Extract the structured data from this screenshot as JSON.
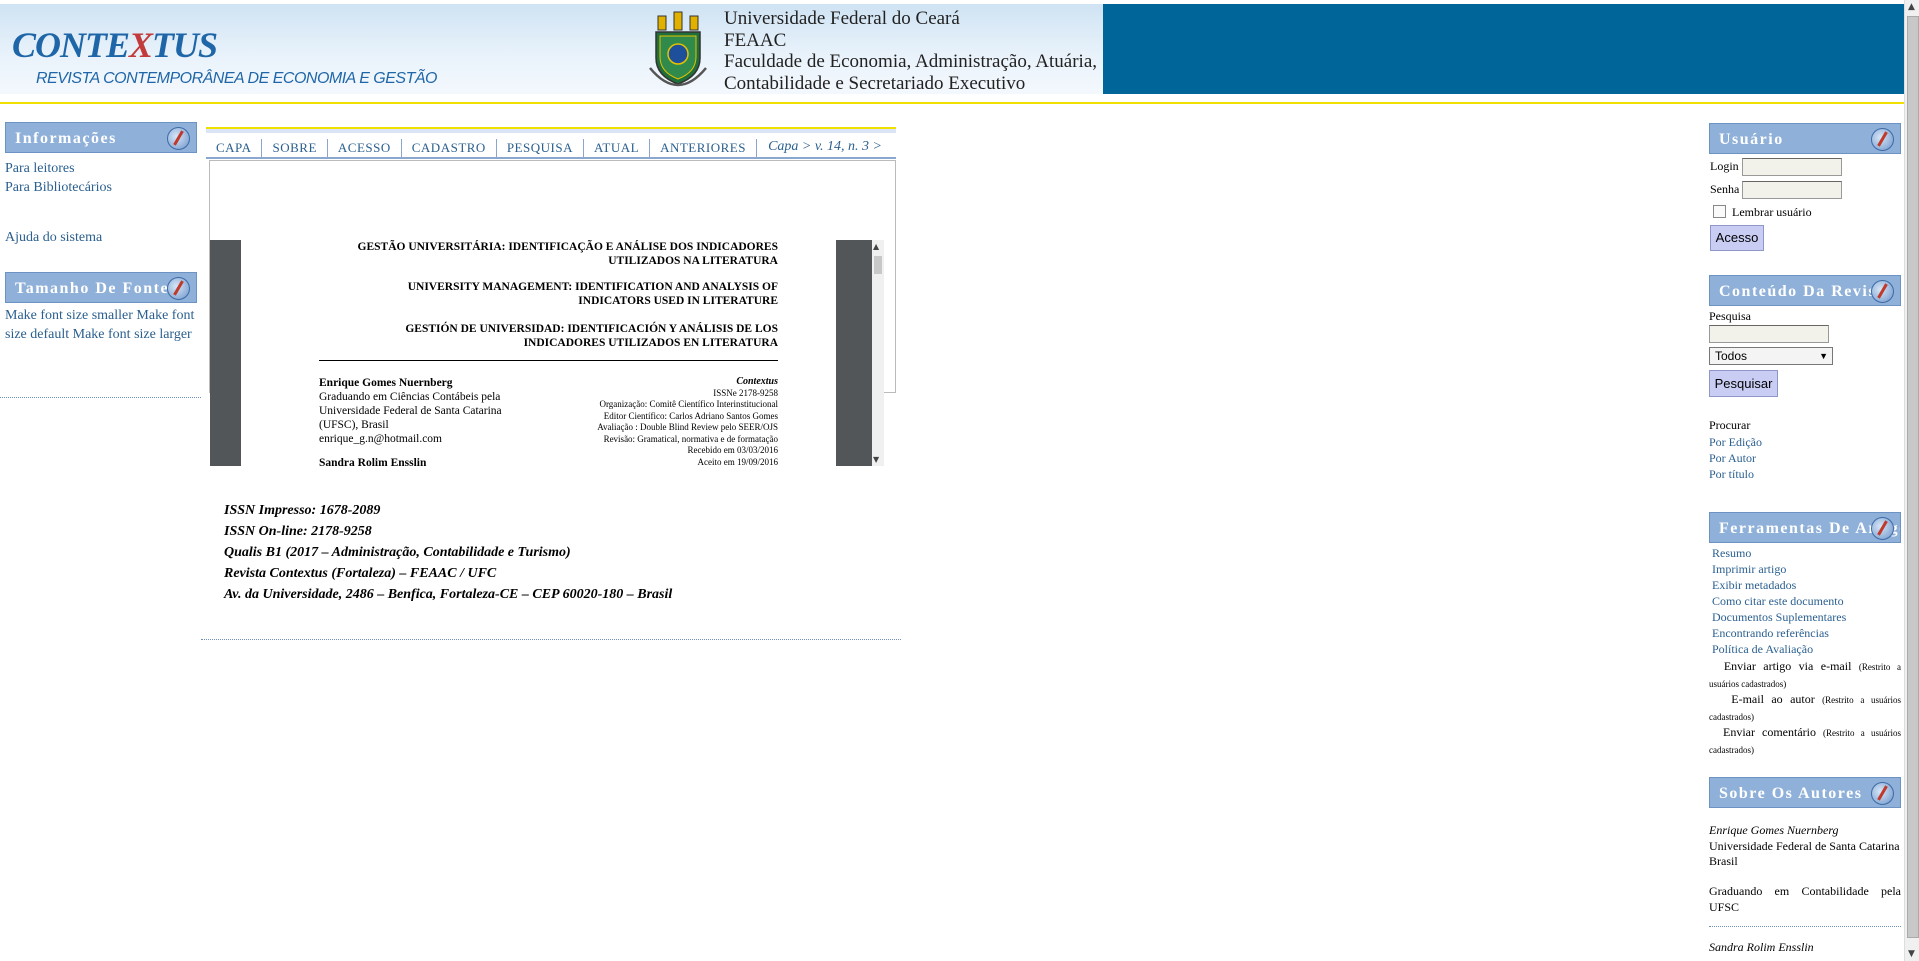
{
  "header": {
    "logo_title_a": "CONTE",
    "logo_title_x": "X",
    "logo_title_b": "TUS",
    "logo_subtitle": "REVISTA CONTEMPORÂNEA DE ECONOMIA E GESTÃO",
    "university_lines": [
      "Universidade Federal do Ceará",
      "FEAAC",
      "Faculdade de Economia, Administração, Atuária,",
      "Contabilidade e Secretariado Executivo"
    ]
  },
  "left_sidebar": {
    "info_header": "Informações",
    "info_links": [
      "Para leitores",
      "Para Bibliotecários"
    ],
    "help_link": "Ajuda do sistema",
    "font_header": "Tamanho De Fonte",
    "font_text": [
      "Make font size smaller Make font",
      "size default Make font size larger"
    ]
  },
  "nav": {
    "items": [
      "CAPA",
      "SOBRE",
      "ACESSO",
      "CADASTRO",
      "PESQUISA",
      "ATUAL",
      "ANTERIORES"
    ],
    "breadcrumb": "Capa > v. 14, n. 3 >"
  },
  "pdf": {
    "title_pt": [
      "GESTÃO UNIVERSITÁRIA: IDENTIFICAÇÃO E ANÁLISE DOS INDICADORES",
      "UTILIZADOS NA LITERATURA"
    ],
    "title_en": [
      "UNIVERSITY MANAGEMENT: IDENTIFICATION AND ANALYSIS OF",
      "INDICATORS USED IN LITERATURE"
    ],
    "title_es": [
      "GESTIÓN DE UNIVERSIDAD: IDENTIFICACIÓN Y ANÁLISIS DE LOS",
      "INDICADORES UTILIZADOS EN LITERATURA"
    ],
    "author_name": "Enrique Gomes Nuernberg",
    "author_lines": [
      "Graduando em Ciências Contábeis pela",
      "Universidade Federal de Santa Catarina",
      "(UFSC), Brasil",
      "enrique_g.n@hotmail.com"
    ],
    "author2_name": "Sandra Rolim Ensslin",
    "journal": "Contextus",
    "meta_lines": [
      "ISSNe 2178-9258",
      "Organização: Comitê Científico Interinstitucional",
      "Editor Científico: Carlos Adriano Santos Gomes",
      "Avaliação : Double Blind Review pelo SEER/OJS",
      "Revisão: Gramatical, normativa e de formatação",
      "Recebido em 03/03/2016",
      "Aceito em 19/09/2016"
    ]
  },
  "issn_lines": [
    "ISSN Impresso: 1678-2089",
    "ISSN On-line: 2178-9258",
    "Qualis B1 (2017 – Administração, Contabilidade e Turismo)",
    "Revista Contextus (Fortaleza) – FEAAC / UFC",
    "Av. da Universidade, 2486 – Benfica, Fortaleza-CE – CEP 60020-180 – Brasil"
  ],
  "right_sidebar": {
    "user_header": "Usuário",
    "login_label": "Login",
    "senha_label": "Senha",
    "remember_label": "Lembrar usuário",
    "acesso_button": "Acesso",
    "content_header": "Conteúdo Da Revista",
    "search_label": "Pesquisa",
    "search_select": "Todos",
    "search_button": "Pesquisar",
    "browse_label": "Procurar",
    "browse_links": [
      "Por Edição",
      "Por Autor",
      "Por título"
    ],
    "tools_header": "Ferramentas De Artigos",
    "tools_links": [
      "Resumo",
      "Imprimir artigo",
      "Exibir metadados",
      "Como citar este documento",
      "Documentos Suplementares",
      "Encontrando referências",
      "Política de Avaliação"
    ],
    "restricted_items": [
      {
        "label": "Enviar artigo via e-mail",
        "note": "(Restrito a usuários cadastrados)"
      },
      {
        "label": "E-mail ao autor",
        "note": "(Restrito a usuários cadastrados)"
      },
      {
        "label": "Enviar comentário",
        "note": "(Restrito a usuários cadastrados)"
      }
    ],
    "authors_header": "Sobre Os Autores",
    "author1_name": "Enrique Gomes Nuernberg",
    "author1_affil": [
      "Universidade Federal de Santa Catarina",
      "Brasil"
    ],
    "author1_bio": "Graduando em Contabilidade pela UFSC",
    "author2_name": "Sandra Rolim Ensslin"
  }
}
